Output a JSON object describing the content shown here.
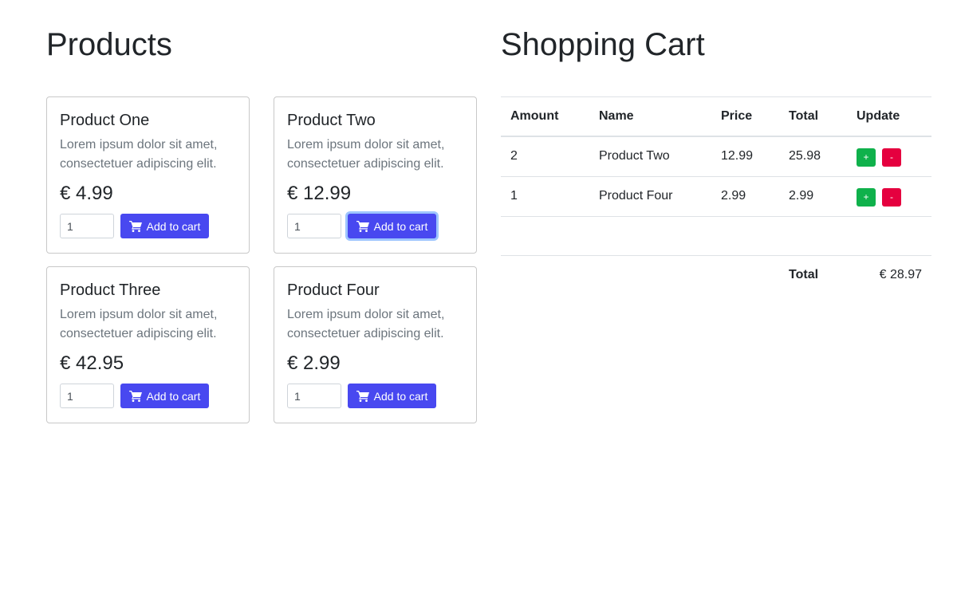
{
  "products": {
    "heading": "Products",
    "items": [
      {
        "title": "Product One",
        "description": "Lorem ipsum dolor sit amet, consectetuer adipiscing elit.",
        "price": "€ 4.99",
        "quantity": "1",
        "button_label": "Add to cart"
      },
      {
        "title": "Product Two",
        "description": "Lorem ipsum dolor sit amet, consectetuer adipiscing elit.",
        "price": "€ 12.99",
        "quantity": "1",
        "button_label": "Add to cart"
      },
      {
        "title": "Product Three",
        "description": "Lorem ipsum dolor sit amet, consectetuer adipiscing elit.",
        "price": "€ 42.95",
        "quantity": "1",
        "button_label": "Add to cart"
      },
      {
        "title": "Product Four",
        "description": "Lorem ipsum dolor sit amet, consectetuer adipiscing elit.",
        "price": "€ 2.99",
        "quantity": "1",
        "button_label": "Add to cart"
      }
    ],
    "button_icon": "cart-icon"
  },
  "cart": {
    "heading": "Shopping Cart",
    "columns": {
      "amount": "Amount",
      "name": "Name",
      "price": "Price",
      "total": "Total",
      "update": "Update"
    },
    "rows": [
      {
        "amount": "2",
        "name": "Product Two",
        "price": "12.99",
        "total": "25.98",
        "plus": "+",
        "minus": "-"
      },
      {
        "amount": "1",
        "name": "Product Four",
        "price": "2.99",
        "total": "2.99",
        "plus": "+",
        "minus": "-"
      }
    ],
    "total_label": "Total",
    "total_value": "€ 28.97"
  },
  "colors": {
    "primary_button": "#4848f0",
    "plus_button": "#0fb14b",
    "minus_button": "#e5003f",
    "focus_ring": "#9ec5fe"
  }
}
